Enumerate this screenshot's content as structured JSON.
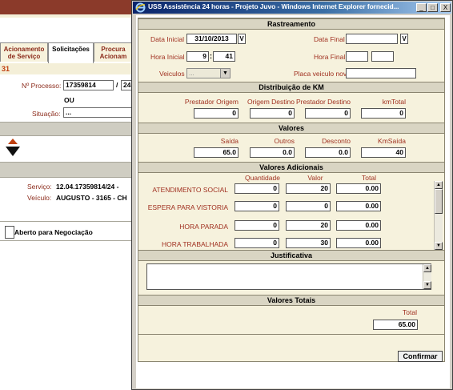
{
  "window": {
    "title": "USS Assistência 24 horas - Projeto Juvo - Windows Internet Explorer fornecid...",
    "controls": {
      "minimize": "_",
      "maximize": "□",
      "close": "X"
    }
  },
  "background_app": {
    "tabs": [
      {
        "label": "Acionamento de Serviço"
      },
      {
        "label": "Solicitações"
      },
      {
        "label": "Procura Acionam"
      }
    ],
    "number": "31",
    "processo": {
      "label": "Nº Processo:",
      "value": "17359814",
      "separator": "/",
      "suffix": "24"
    },
    "ou": "OU",
    "situacao": {
      "label": "Situação:",
      "value": "..."
    },
    "servico": {
      "label": "Serviço:",
      "value": "12.04.17359814/24 -"
    },
    "veiculo": {
      "label": "Veículo:",
      "value": "AUGUSTO - 3165 - CH"
    },
    "negociacao": {
      "label": "Aberto para Negociação"
    }
  },
  "rastreamento": {
    "title": "Rastreamento",
    "data_inicial": {
      "label": "Data Inicial",
      "value": "31/10/2013",
      "button": "V"
    },
    "data_final": {
      "label": "Data Final",
      "value": "",
      "button": "V"
    },
    "hora_inicial": {
      "label": "Hora Inicial",
      "hour": "9",
      "minute": "41",
      "separator": ":"
    },
    "hora_final": {
      "label": "Hora Final",
      "hour": "",
      "minute": ""
    },
    "veiculos": {
      "label": "Veiculos",
      "value": "..."
    },
    "placa": {
      "label": "Placa veiculo novo",
      "value": ""
    }
  },
  "distribuicao": {
    "title": "Distribuição de KM",
    "fields": [
      {
        "label": "Prestador Origem",
        "value": "0"
      },
      {
        "label": "Origem Destino",
        "value": "0"
      },
      {
        "label": "Prestador Destino",
        "value": "0"
      },
      {
        "label": "kmTotal",
        "value": "0"
      }
    ]
  },
  "valores": {
    "title": "Valores",
    "fields": [
      {
        "label": "Saída",
        "value": "65.0"
      },
      {
        "label": "Outros",
        "value": "0.0"
      },
      {
        "label": "Desconto",
        "value": "0.0"
      },
      {
        "label": "KmSaída",
        "value": "40"
      }
    ]
  },
  "adicionais": {
    "title": "Valores Adicionais",
    "headers": {
      "quantidade": "Quantidade",
      "valor": "Valor",
      "total": "Total"
    },
    "rows": [
      {
        "label": "ATENDIMENTO SOCIAL",
        "quantidade": "0",
        "valor": "20",
        "total": "0.00"
      },
      {
        "label": "ESPERA PARA VISTORIA",
        "quantidade": "0",
        "valor": "0",
        "total": "0.00"
      },
      {
        "label": "HORA PARADA",
        "quantidade": "0",
        "valor": "20",
        "total": "0.00"
      },
      {
        "label": "HORA TRABALHADA",
        "quantidade": "0",
        "valor": "30",
        "total": "0.00"
      }
    ]
  },
  "justificativa": {
    "title": "Justificativa",
    "value": ""
  },
  "totais": {
    "title": "Valores Totais",
    "total_label": "Total",
    "total_value": "65.00"
  },
  "confirm_label": "Confirmar",
  "colors": {
    "section_header": "#d9d5c3",
    "panel_bg": "#f6f2dd",
    "label_text": "#a03020",
    "titlebar": "#0a246a"
  }
}
